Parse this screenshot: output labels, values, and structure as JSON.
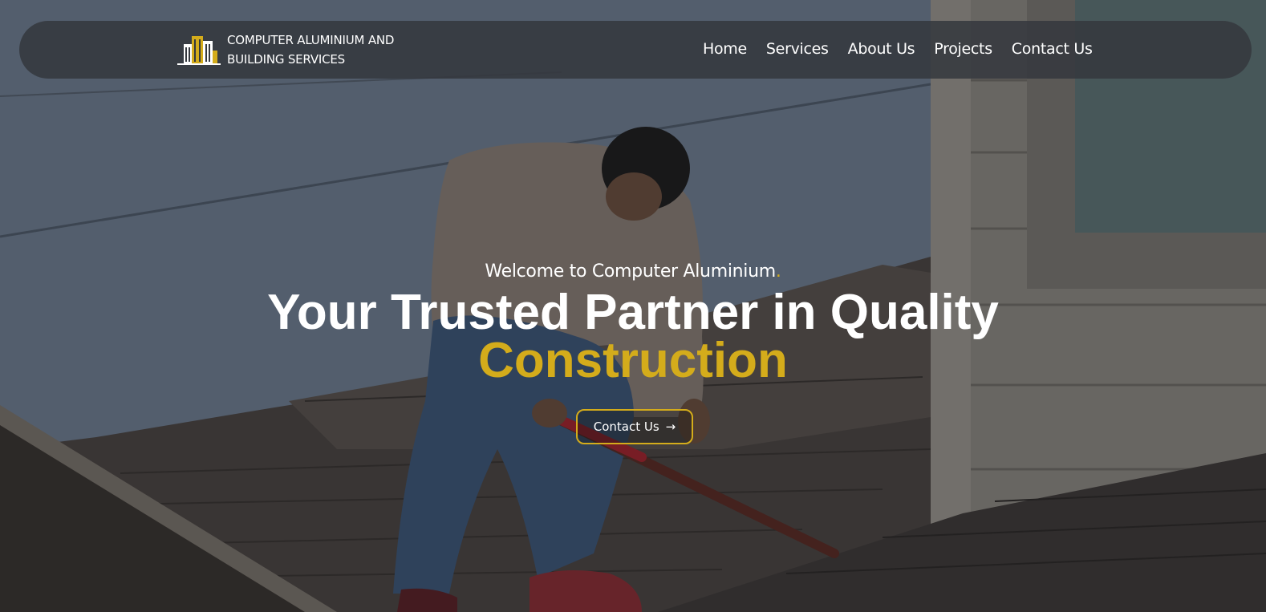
{
  "nav": {
    "logo_icon": "building-icon",
    "brand_line1": "COMPUTER ALUMINIUM AND",
    "brand_line2": "BUILDING SERVICES",
    "links": [
      {
        "label": "Home"
      },
      {
        "label": "Services"
      },
      {
        "label": "About Us"
      },
      {
        "label": "Projects"
      },
      {
        "label": "Contact Us"
      }
    ]
  },
  "hero": {
    "welcome": "Welcome to Computer Aluminium",
    "welcome_dot": ".",
    "headline_line1": "Your Trusted Partner in Quality",
    "headline_line2": "Construction",
    "cta_label": "Contact Us",
    "cta_icon": "arrow-right-icon",
    "background": "roofer-working-on-roof-photo"
  },
  "colors": {
    "accent": "#d4ac1b",
    "navbar": "#34383e",
    "text": "#ffffff"
  }
}
